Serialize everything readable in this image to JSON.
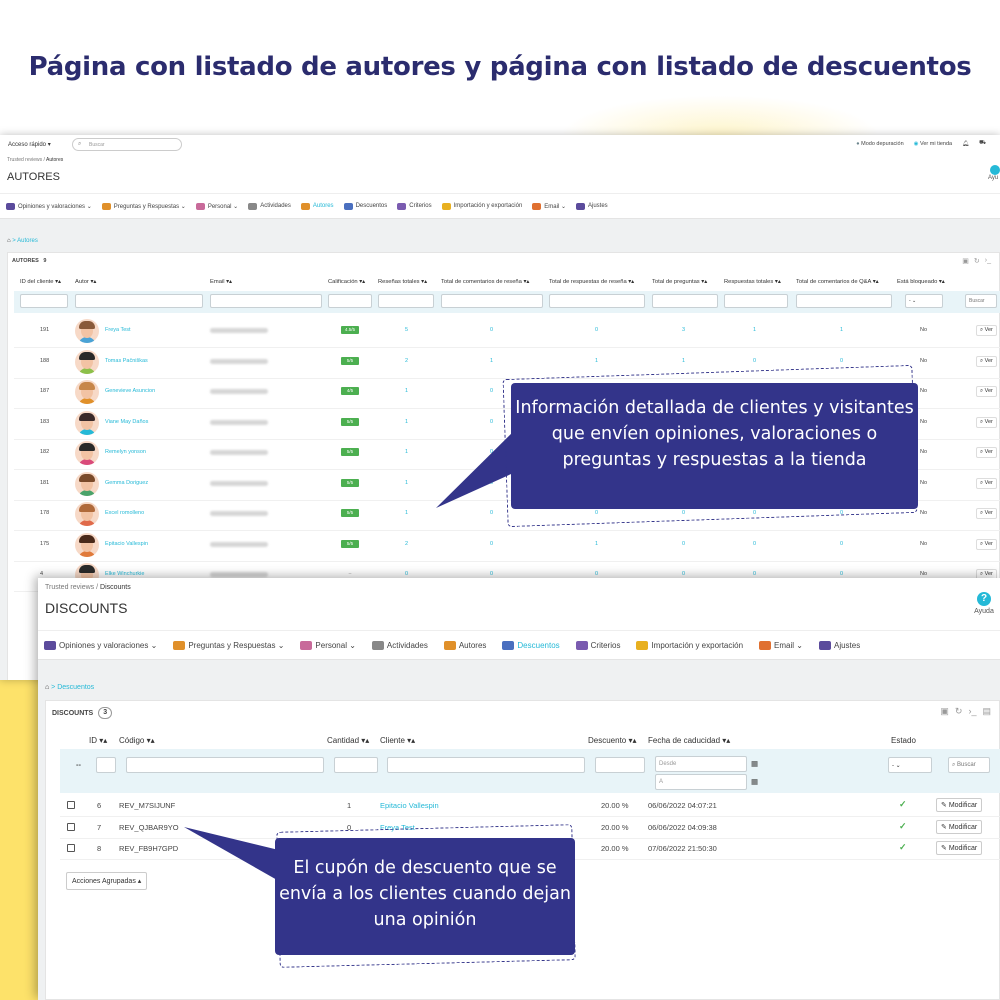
{
  "headline": "Página con listado de autores y página con listado de descuentos",
  "authors_page": {
    "topbar": {
      "quick_access": "Acceso rápido ▾",
      "search_placeholder": "Buscar",
      "debug_mode": "Modo depuración",
      "view_store": "Ver mi tienda"
    },
    "breadcrumb": {
      "root": "Trusted reviews",
      "sep": "/",
      "current": "Autores"
    },
    "title": "AUTORES",
    "help": "Ayu",
    "home_crumb": "Autores",
    "tabs": [
      {
        "label": "Opiniones y valoraciones ⌄",
        "color": "#5b4b9c"
      },
      {
        "label": "Preguntas y Respuestas ⌄",
        "color": "#e0902a"
      },
      {
        "label": "Personal ⌄",
        "color": "#c86a9a"
      },
      {
        "label": "Actividades",
        "color": "#888888"
      },
      {
        "label": "Autores",
        "color": "#e0902a",
        "active": true
      },
      {
        "label": "Descuentos",
        "color": "#4a6fbf"
      },
      {
        "label": "Criterios",
        "color": "#7a5bb0"
      },
      {
        "label": "Importación y exportación",
        "color": "#e8b020"
      },
      {
        "label": "Email ⌄",
        "color": "#e07030"
      },
      {
        "label": "Ajustes",
        "color": "#5b4b9c"
      }
    ],
    "panel_title": "AUTORES",
    "panel_count": "9",
    "columns": [
      "ID del cliente ▾▴",
      "Autor ▾▴",
      "Email ▾▴",
      "Calificación ▾▴",
      "Reseñas totales ▾▴",
      "Total de comentarios de reseña ▾▴",
      "Total de respuestas de reseña ▾▴",
      "Total de preguntas ▾▴",
      "Respuestas totales ▾▴",
      "Total de comentarios de Q&A ▾▴",
      "Está bloqueado ▾▴"
    ],
    "filter_select": "- ⌄",
    "filter_search": "Buscar",
    "view_label": "Ver",
    "rows": [
      {
        "id": "191",
        "author": "Freya Test",
        "grade": "4.5/5",
        "reviews": "5",
        "rev_comments": "0",
        "rev_answers": "0",
        "questions": "3",
        "answers": "1",
        "qa_comments": "1",
        "blocked": "No"
      },
      {
        "id": "188",
        "author": "Tomas Pačniškas",
        "grade": "5/5",
        "reviews": "2",
        "rev_comments": "1",
        "rev_answers": "1",
        "questions": "1",
        "answers": "0",
        "qa_comments": "0",
        "blocked": "No"
      },
      {
        "id": "187",
        "author": "Genevieve Asuncion",
        "grade": "4/5",
        "reviews": "1",
        "rev_comments": "0",
        "rev_answers": "",
        "questions": "",
        "answers": "",
        "qa_comments": "",
        "blocked": "No"
      },
      {
        "id": "183",
        "author": "Viane May Daños",
        "grade": "5/5",
        "reviews": "1",
        "rev_comments": "0",
        "rev_answers": "",
        "questions": "",
        "answers": "",
        "qa_comments": "",
        "blocked": "No"
      },
      {
        "id": "182",
        "author": "Remelyn yonson",
        "grade": "5/5",
        "reviews": "1",
        "rev_comments": "0",
        "rev_answers": "",
        "questions": "",
        "answers": "",
        "qa_comments": "",
        "blocked": "No"
      },
      {
        "id": "181",
        "author": "Gemma Doriguez",
        "grade": "5/5",
        "reviews": "1",
        "rev_comments": "0",
        "rev_answers": "",
        "questions": "",
        "answers": "",
        "qa_comments": "",
        "blocked": "No"
      },
      {
        "id": "178",
        "author": "Excel romolleno",
        "grade": "5/5",
        "reviews": "1",
        "rev_comments": "0",
        "rev_answers": "0",
        "questions": "0",
        "answers": "0",
        "qa_comments": "0",
        "blocked": "No"
      },
      {
        "id": "175",
        "author": "Epitacio Vallespin",
        "grade": "5/5",
        "reviews": "2",
        "rev_comments": "0",
        "rev_answers": "1",
        "questions": "0",
        "answers": "0",
        "qa_comments": "0",
        "blocked": "No"
      },
      {
        "id": "4",
        "author": "Elke Winchurkie",
        "grade": "--",
        "reviews": "0",
        "rev_comments": "0",
        "rev_answers": "0",
        "questions": "0",
        "answers": "0",
        "qa_comments": "0",
        "blocked": "No"
      }
    ]
  },
  "discounts_page": {
    "breadcrumb": {
      "root": "Trusted reviews",
      "sep": "/",
      "current": "Discounts"
    },
    "title": "DISCOUNTS",
    "help": "Ayuda",
    "home_crumb": "Descuentos",
    "tabs": [
      {
        "label": "Opiniones y valoraciones ⌄",
        "color": "#5b4b9c"
      },
      {
        "label": "Preguntas y Respuestas ⌄",
        "color": "#e0902a"
      },
      {
        "label": "Personal ⌄",
        "color": "#c86a9a"
      },
      {
        "label": "Actividades",
        "color": "#888888"
      },
      {
        "label": "Autores",
        "color": "#e0902a"
      },
      {
        "label": "Descuentos",
        "color": "#4a6fbf",
        "active": true
      },
      {
        "label": "Criterios",
        "color": "#7a5bb0"
      },
      {
        "label": "Importación y exportación",
        "color": "#e8b020"
      },
      {
        "label": "Email ⌄",
        "color": "#e07030"
      },
      {
        "label": "Ajustes",
        "color": "#5b4b9c"
      }
    ],
    "panel_title": "DISCOUNTS",
    "panel_count": "3",
    "columns": [
      "ID ▾▴",
      "Código ▾▴",
      "Cantidad ▾▴",
      "Cliente ▾▴",
      "Descuento ▾▴",
      "Fecha de caducidad ▾▴",
      "Estado"
    ],
    "filter_dash": "--",
    "date_from": "Desde",
    "date_to": "A",
    "status_select": "- ⌄",
    "search_button": "Buscar",
    "modify_label": "Modificar",
    "bulk_actions": "Acciones Agrupadas ▴",
    "rows": [
      {
        "id": "6",
        "code": "REV_M7SIJUNF",
        "qty": "1",
        "client": "Epitacio Vallespin",
        "discount": "20.00 %",
        "expiry": "06/06/2022 04:07:21"
      },
      {
        "id": "7",
        "code": "REV_QJBAR9YO",
        "qty": "0",
        "client": "Freya Test",
        "discount": "20.00 %",
        "expiry": "06/06/2022 04:09:38"
      },
      {
        "id": "8",
        "code": "REV_FB9H7GPD",
        "qty": "",
        "client": "",
        "discount": "20.00 %",
        "expiry": "07/06/2022 21:50:30"
      }
    ]
  },
  "callouts": {
    "authors": "Información detallada de clientes y visitantes que envíen opiniones, valoraciones o preguntas y respuestas a la tienda",
    "discounts": "El cupón de descuento que se envía a los clientes cuando dejan una opinión"
  },
  "colors": {
    "accent": "#25b9d7",
    "callout": "#33348a",
    "headline": "#2b2c6e",
    "grade_green": "#4caf50",
    "yellow": "#fde26a"
  }
}
